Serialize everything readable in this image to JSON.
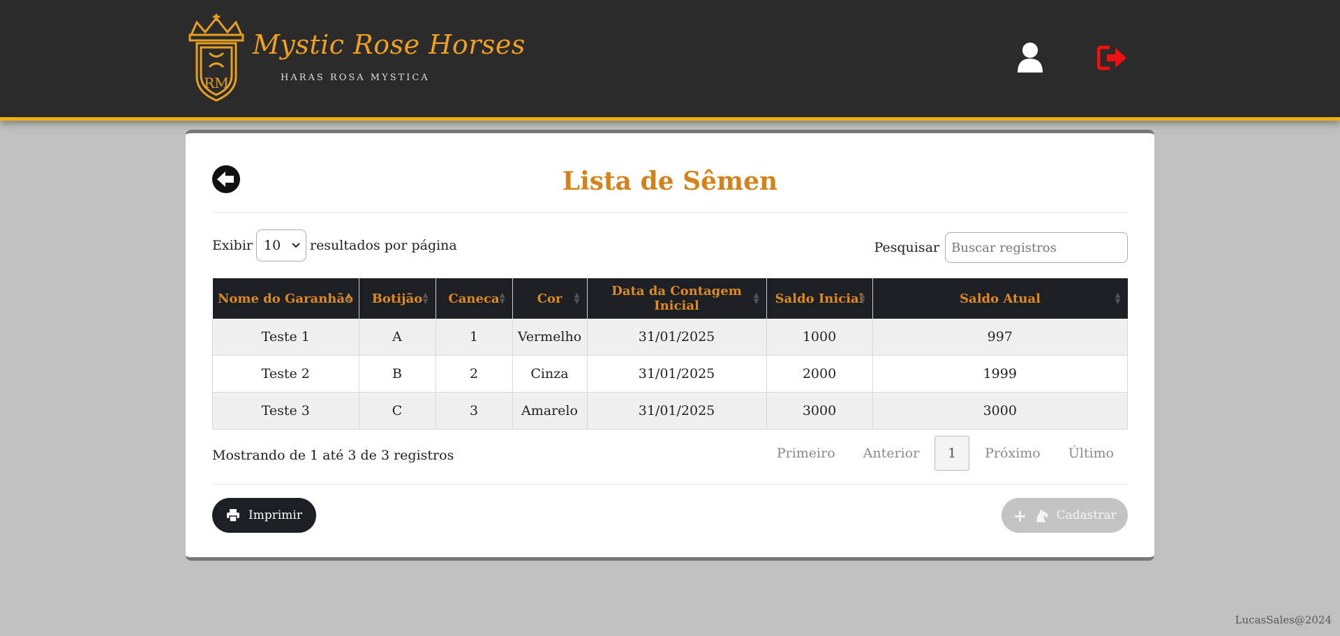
{
  "header": {
    "brand_name": "Mystic Rose Horses",
    "brand_tagline": "HARAS ROSA MYSTICA",
    "logo_initials": "RM",
    "accent_color": "#f0b400",
    "logo_color": "#e8a020",
    "logout_color": "#ee1111"
  },
  "page": {
    "title": "Lista de Sêmen",
    "title_color": "#d4821a"
  },
  "controls": {
    "show_label": "Exibir",
    "page_size": "10",
    "per_page_label": "resultados por página",
    "search_label": "Pesquisar",
    "search_placeholder": "Buscar registros"
  },
  "table": {
    "columns": [
      "Nome do Garanhão",
      "Botijão",
      "Caneca",
      "Cor",
      "Data da Contagem Inicial",
      "Saldo Inicial",
      "Saldo Atual"
    ],
    "sorted_column": "Nome do Garanhão",
    "sort_direction": "ascending",
    "rows": [
      [
        "Teste 1",
        "A",
        "1",
        "Vermelho",
        "31/01/2025",
        "1000",
        "997"
      ],
      [
        "Teste 2",
        "B",
        "2",
        "Cinza",
        "31/01/2025",
        "2000",
        "1999"
      ],
      [
        "Teste 3",
        "C",
        "3",
        "Amarelo",
        "31/01/2025",
        "3000",
        "3000"
      ]
    ]
  },
  "summary": {
    "info": "Mostrando de 1 até 3 de 3 registros"
  },
  "pagination": {
    "first": "Primeiro",
    "previous": "Anterior",
    "current": "1",
    "next": "Próximo",
    "last": "Último"
  },
  "actions": {
    "print_label": "Imprimir",
    "add_label": "Cadastrar"
  },
  "footer": {
    "credit": "LucasSales@2024"
  }
}
